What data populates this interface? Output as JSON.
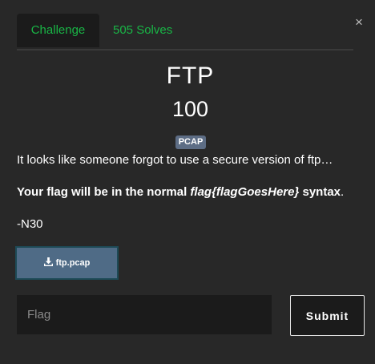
{
  "modal": {
    "close_glyph": "×"
  },
  "tabs": {
    "challenge": "Challenge",
    "solves": "505 Solves"
  },
  "challenge": {
    "name": "FTP",
    "value": "100",
    "tag": "PCAP",
    "description": "It looks like someone forgot to use a secure version of ftp…",
    "flag_note_prefix": "Your flag will be in the normal ",
    "flag_note_format": "flag{flagGoesHere}",
    "flag_note_suffix": " syntax",
    "flag_note_period": ".",
    "author": "-N30"
  },
  "file": {
    "name": "ftp.pcap",
    "icon": "download-icon"
  },
  "submission": {
    "placeholder": "Flag",
    "value": "",
    "submit_label": "Submit"
  },
  "colors": {
    "background": "#282828",
    "panel": "#1b1b1b",
    "accent": "#19b546",
    "badge": "#5d6d85",
    "file_button": "#4f6b86"
  }
}
